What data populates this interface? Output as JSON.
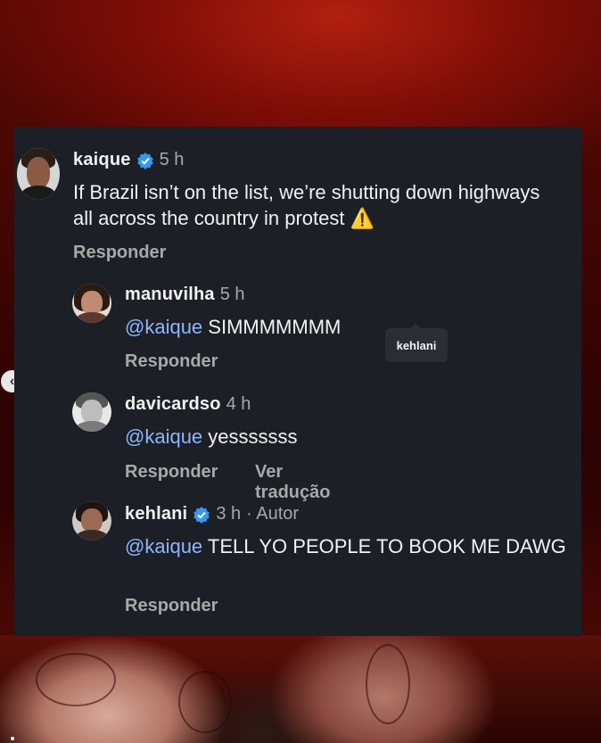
{
  "comments": [
    {
      "username": "kaique",
      "verified": true,
      "time": "5 h",
      "text_before": "If Brazil isn’t on the list, we’re shutting down highways all across the country in protest",
      "emoji": "⚠️",
      "reply_label": "Responder"
    },
    {
      "username": "manuvilha",
      "time": "5 h",
      "mention": "@kaique",
      "text": " SIMMMMMMM",
      "reply_label": "Responder"
    },
    {
      "username": "davicardso",
      "time": "4 h",
      "mention": "@kaique",
      "text": " yesssssss",
      "reply_label": "Responder",
      "translate_label": "Ver tradução"
    },
    {
      "username": "kehlani",
      "verified": true,
      "time": "3 h",
      "author_tag": "· Autor",
      "mention": "@kaique",
      "text": " TELL YO PEOPLE TO BOOK ME DAWG",
      "reply_label": "Responder"
    }
  ],
  "tooltip": {
    "label": "kehlani"
  },
  "nav": {
    "prev_icon": "chevron-left-icon"
  },
  "colors": {
    "card_bg": "#1c1f26",
    "mention": "#8fb6ff",
    "secondary_text": "#a8a8a8",
    "verified": "#3897f0"
  }
}
